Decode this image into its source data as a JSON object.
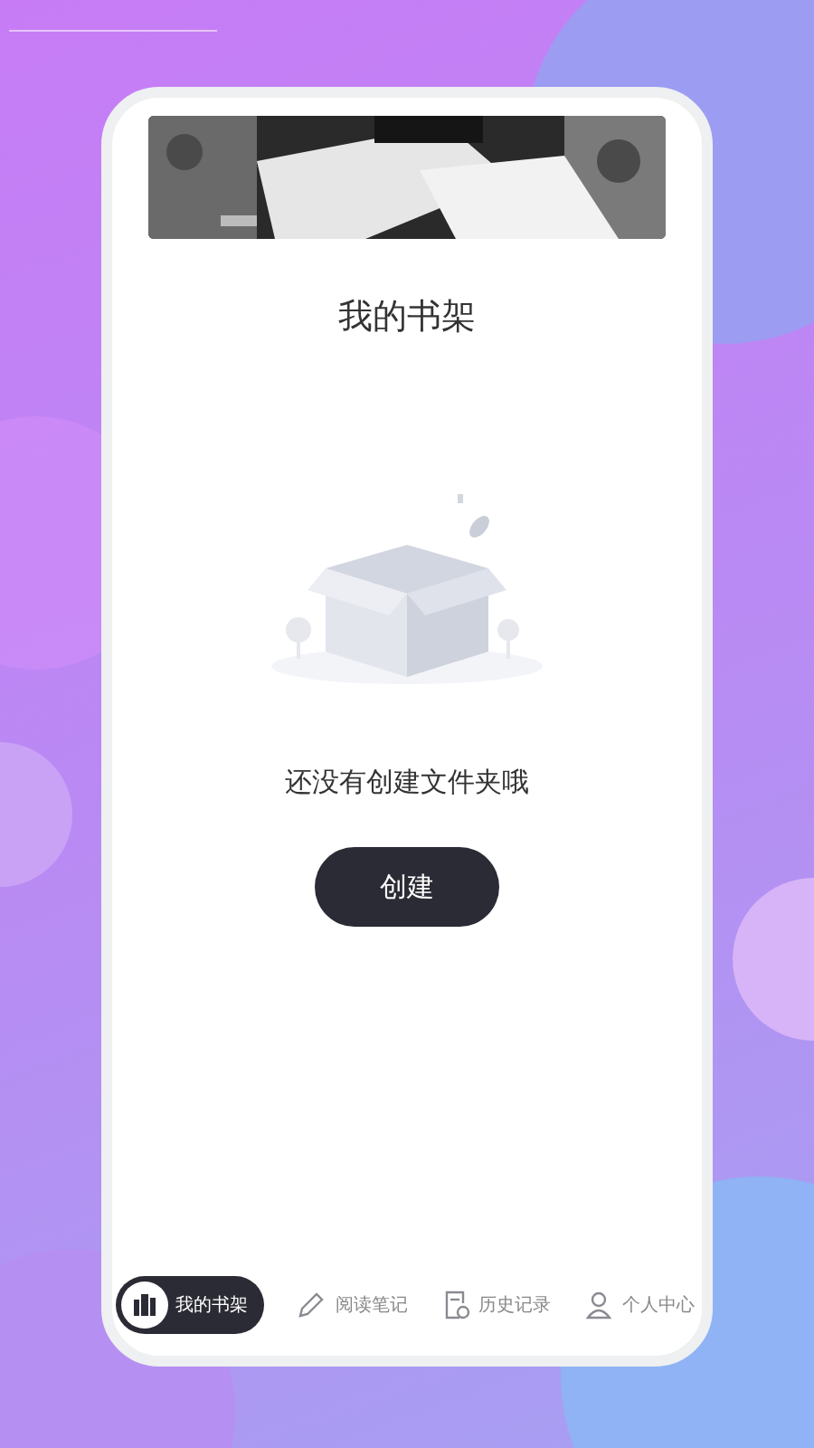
{
  "title": "我的书架",
  "empty_state": {
    "message": "还没有创建文件夹哦"
  },
  "create_button": {
    "label": "创建"
  },
  "tabs": [
    {
      "label": "我的书架",
      "kind": "shelf",
      "selected": true
    },
    {
      "label": "阅读笔记",
      "kind": "pencil",
      "selected": false
    },
    {
      "label": "历史记录",
      "kind": "history",
      "selected": false
    },
    {
      "label": "个人中心",
      "kind": "person",
      "selected": false
    }
  ]
}
